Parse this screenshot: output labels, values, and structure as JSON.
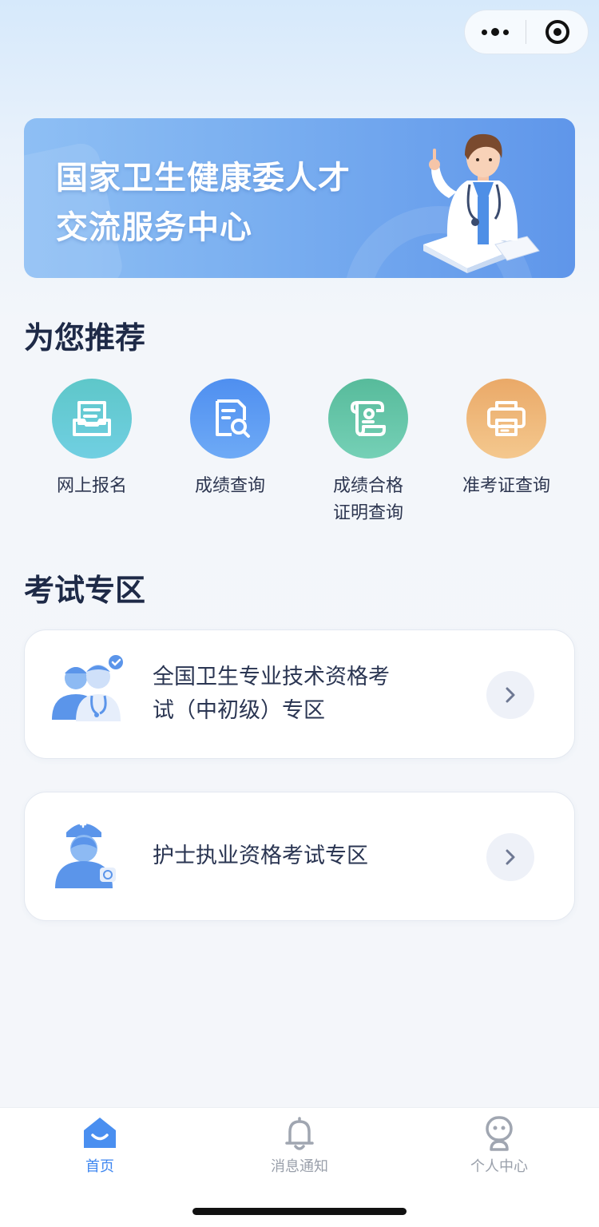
{
  "banner": {
    "line1": "国家卫生健康委人才",
    "line2": "交流服务中心"
  },
  "recommend": {
    "title": "为您推荐",
    "items": [
      {
        "label": "网上报名",
        "icon": "inbox-form-icon",
        "color": "#62c6cf"
      },
      {
        "label": "成绩查询",
        "icon": "document-search-icon",
        "color": "#5f9cf0"
      },
      {
        "label": "成绩合格",
        "label2": "证明查询",
        "icon": "certificate-scroll-icon",
        "color": "#5fc1a4"
      },
      {
        "label": "准考证查询",
        "icon": "printer-icon",
        "color": "#efb976"
      }
    ]
  },
  "exam_zone": {
    "title": "考试专区",
    "cards": [
      {
        "line1": "全国卫生专业技术资格考",
        "line2": "试（中初级）专区",
        "art": "medical-staff-icon"
      },
      {
        "line1": "护士执业资格考试专区",
        "art": "nurse-icon"
      }
    ]
  },
  "tabbar": {
    "items": [
      {
        "label": "首页",
        "icon": "home-icon",
        "active": true,
        "color": "#3f87f0"
      },
      {
        "label": "消息通知",
        "icon": "bell-icon",
        "active": false
      },
      {
        "label": "个人中心",
        "icon": "user-avatar-icon",
        "active": false
      }
    ]
  }
}
